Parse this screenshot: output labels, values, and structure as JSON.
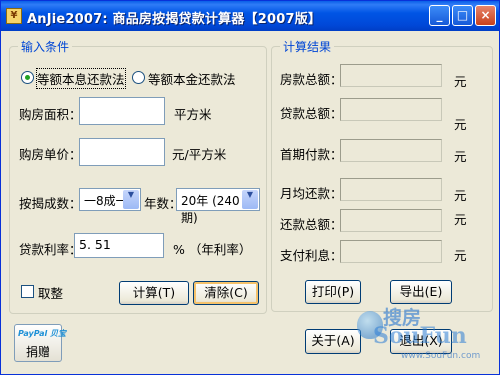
{
  "window": {
    "title": "AnJie2007: 商品房按揭贷款计算器【2007版】",
    "app_icon": "calculator-icon",
    "controls": {
      "minimize": "_",
      "maximize": "□",
      "close": "×"
    }
  },
  "input_group": {
    "title": "输入条件",
    "radio_equal_installment": "等额本息还款法",
    "radio_equal_principal": "等额本金还款法",
    "selected_method": "等额本息还款法",
    "area_label": "购房面积：",
    "area_value": "",
    "area_unit": "平方米",
    "price_label": "购房单价：",
    "price_value": "",
    "price_unit": "元/平方米",
    "ratio_label": "按揭成数：",
    "ratio_value": "一8成一",
    "years_label": "年数：",
    "years_value": "20年 (240期)",
    "rate_label": "贷款利率：",
    "rate_value": "5. 51",
    "rate_unit": "% （年利率）",
    "round_label": "取整",
    "calc_button": "计算(T)",
    "clear_button": "清除(C)"
  },
  "result_group": {
    "title": "计算结果",
    "rows": [
      {
        "label": "房款总额：",
        "unit": "元"
      },
      {
        "label": "贷款总额：",
        "unit": "元"
      },
      {
        "label": "首期付款：",
        "unit": "元"
      },
      {
        "label": "月均还款：",
        "unit": "元"
      },
      {
        "label": "还款总额：",
        "unit": "元"
      },
      {
        "label": "支付利息：",
        "unit": "元"
      }
    ],
    "print_button": "打印(P)",
    "export_button": "导出(E)"
  },
  "footer": {
    "paypal_logo_a": "PayPal",
    "paypal_logo_b": "贝宝",
    "donate_label": "捐赠",
    "about_button": "关于(A)",
    "exit_button": "退出(X)"
  },
  "watermark": {
    "cn": "搜房",
    "en": "SouFun",
    "url": "www.SouFun.com"
  }
}
